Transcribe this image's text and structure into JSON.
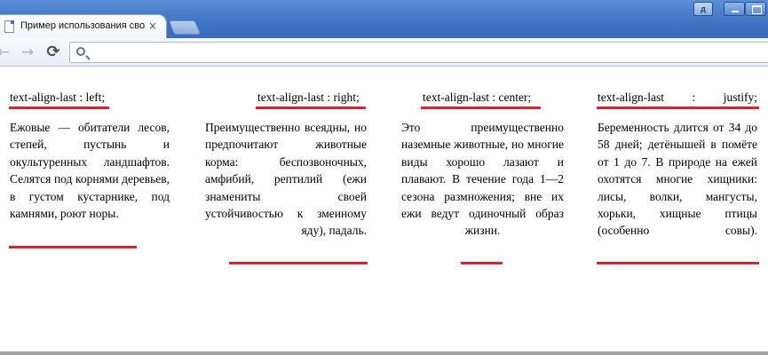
{
  "browser": {
    "tab_title": "Пример использования сво",
    "tab_close": "×",
    "user_badge": "д",
    "back": "←",
    "forward": "→",
    "reload": "⟳",
    "address": ""
  },
  "columns": [
    {
      "heading": "text-align-last : left;",
      "text": "Ежовые — обитатели лесов, степей, пустынь и окультуренных ландшафтов. Селятся под корнями деревьев, в густом кустарнике, под камнями, роют норы."
    },
    {
      "heading": "text-align-last : right;",
      "text": "Преимущественно всеядны, но предпочитают животные корма: беспозвоночных, амфибий, рептилий (ежи знамениты своей устойчивостью к змеиному яду), падаль."
    },
    {
      "heading": "text-align-last : center;",
      "text": "Это преимущественно наземные животные, но многие виды хорошо лазают и плавают. В течение года 1—2 сезона размножения; вне их ежи ведут одиночный образ жизни."
    },
    {
      "heading": "text-align-last : justify;",
      "text": "Беременность длится от 34 до 58 дней; детёнышей в помёте от 1 до 7. В природе на ежей охотятся многие хищники: лисы, волки, мангусты, хорьки, хищные птицы (особенно совы)."
    }
  ],
  "colors": {
    "underline": "#e0202c",
    "titlebar": "#3f73c4"
  }
}
